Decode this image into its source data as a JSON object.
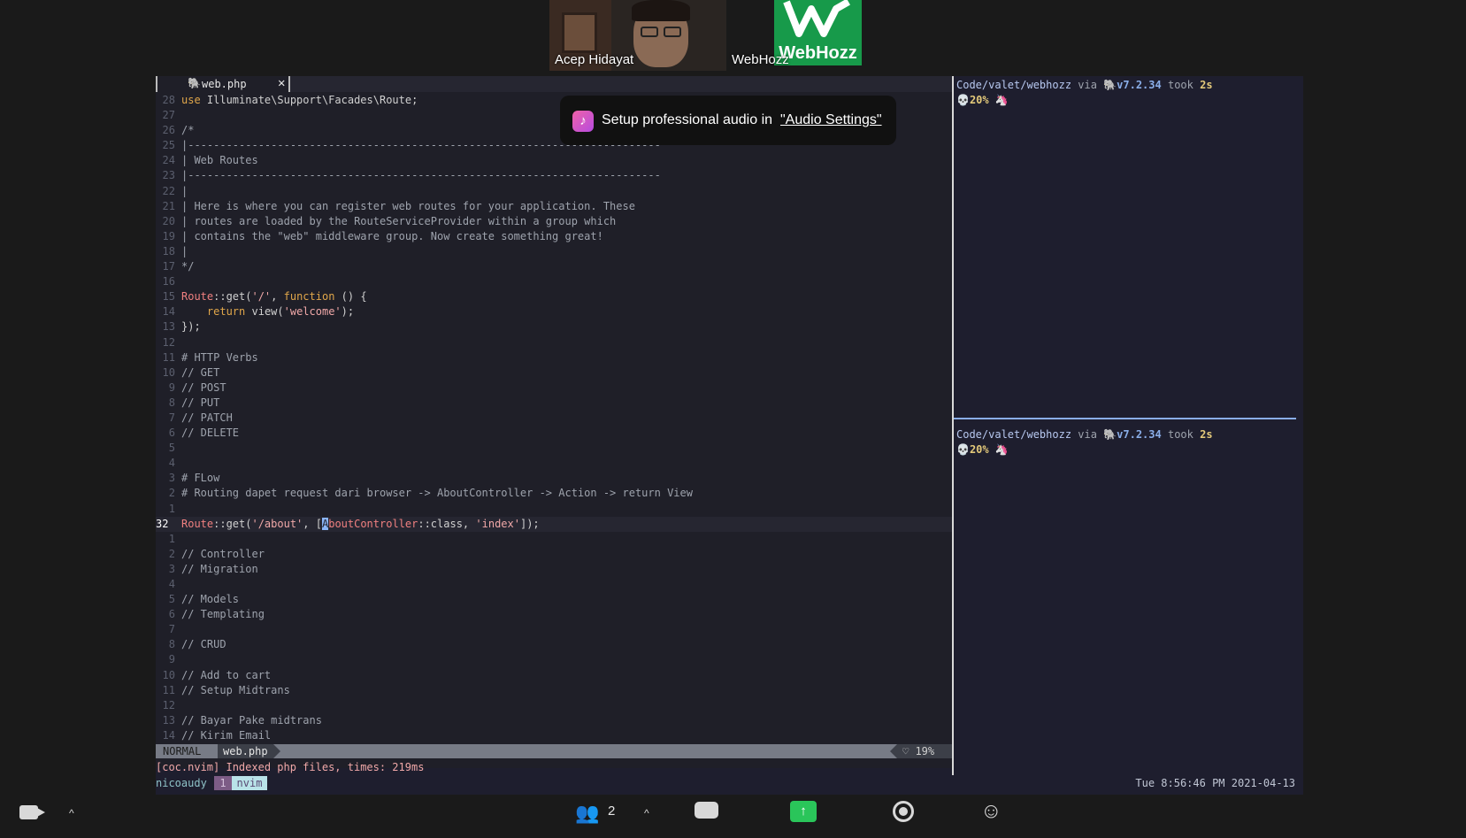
{
  "meeting": {
    "participants": [
      {
        "name": "Acep Hidayat"
      },
      {
        "name": "WebHozz"
      }
    ],
    "webhozz_logo_text": "WebHozz"
  },
  "toast": {
    "text": "Setup professional audio in",
    "link": "\"Audio Settings\""
  },
  "editor": {
    "tab_label": "web.php",
    "tab_close": "✕",
    "lines": [
      {
        "n": "28",
        "parts": [
          [
            "kw",
            "use"
          ],
          [
            "fn",
            " Illuminate\\Support\\Facades\\Route;"
          ]
        ]
      },
      {
        "n": "27",
        "parts": []
      },
      {
        "n": "26",
        "parts": [
          [
            "comment",
            "/*"
          ]
        ]
      },
      {
        "n": "25",
        "parts": [
          [
            "comment",
            "|--------------------------------------------------------------------------"
          ]
        ]
      },
      {
        "n": "24",
        "parts": [
          [
            "comment",
            "| Web Routes"
          ]
        ]
      },
      {
        "n": "23",
        "parts": [
          [
            "comment",
            "|--------------------------------------------------------------------------"
          ]
        ]
      },
      {
        "n": "22",
        "parts": [
          [
            "comment",
            "|"
          ]
        ]
      },
      {
        "n": "21",
        "parts": [
          [
            "comment",
            "| Here is where you can register web routes for your application. These"
          ]
        ]
      },
      {
        "n": "20",
        "parts": [
          [
            "comment",
            "| routes are loaded by the RouteServiceProvider within a group which"
          ]
        ]
      },
      {
        "n": "19",
        "parts": [
          [
            "comment",
            "| contains the \"web\" middleware group. Now create something great!"
          ]
        ]
      },
      {
        "n": "18",
        "parts": [
          [
            "comment",
            "|"
          ]
        ]
      },
      {
        "n": "17",
        "parts": [
          [
            "comment",
            "*/"
          ]
        ]
      },
      {
        "n": "16",
        "parts": []
      },
      {
        "n": "15",
        "parts": [
          [
            "cls",
            "Route"
          ],
          [
            "fn",
            "::get("
          ],
          [
            "str",
            "'/'"
          ],
          [
            "fn",
            ", "
          ],
          [
            "kw",
            "function"
          ],
          [
            "fn",
            " () {"
          ]
        ]
      },
      {
        "n": "14",
        "parts": [
          [
            "fn",
            "    "
          ],
          [
            "kw",
            "return"
          ],
          [
            "fn",
            " view("
          ],
          [
            "str",
            "'welcome'"
          ],
          [
            "fn",
            ");"
          ]
        ]
      },
      {
        "n": "13",
        "parts": [
          [
            "fn",
            "});"
          ]
        ]
      },
      {
        "n": "12",
        "parts": []
      },
      {
        "n": "11",
        "parts": [
          [
            "comment",
            "# HTTP Verbs"
          ]
        ]
      },
      {
        "n": "10",
        "parts": [
          [
            "comment",
            "// GET"
          ]
        ]
      },
      {
        "n": "9",
        "parts": [
          [
            "comment",
            "// POST"
          ]
        ]
      },
      {
        "n": "8",
        "parts": [
          [
            "comment",
            "// PUT"
          ]
        ]
      },
      {
        "n": "7",
        "parts": [
          [
            "comment",
            "// PATCH"
          ]
        ]
      },
      {
        "n": "6",
        "parts": [
          [
            "comment",
            "// DELETE"
          ]
        ]
      },
      {
        "n": "5",
        "parts": []
      },
      {
        "n": "4",
        "parts": []
      },
      {
        "n": "3",
        "parts": [
          [
            "comment",
            "# FLow"
          ]
        ]
      },
      {
        "n": "2",
        "parts": [
          [
            "comment",
            "# Routing dapet request dari browser -> AboutController -> Action -> return View"
          ]
        ]
      },
      {
        "n": "1",
        "parts": []
      },
      {
        "n": "32",
        "current": true,
        "parts": [
          [
            "cls",
            "Route"
          ],
          [
            "fn",
            "::get("
          ],
          [
            "str",
            "'/about'"
          ],
          [
            "fn",
            ", ["
          ],
          [
            "cursor",
            "A"
          ],
          [
            "cls",
            "b"
          ],
          [
            "cls",
            "outController"
          ],
          [
            "fn",
            "::class, "
          ],
          [
            "str",
            "'index'"
          ],
          [
            "fn",
            "]);"
          ]
        ]
      },
      {
        "n": "1",
        "parts": []
      },
      {
        "n": "2",
        "parts": [
          [
            "comment",
            "// Controller"
          ]
        ]
      },
      {
        "n": "3",
        "parts": [
          [
            "comment",
            "// Migration"
          ]
        ]
      },
      {
        "n": "4",
        "parts": []
      },
      {
        "n": "5",
        "parts": [
          [
            "comment",
            "// Models"
          ]
        ]
      },
      {
        "n": "6",
        "parts": [
          [
            "comment",
            "// Templating"
          ]
        ]
      },
      {
        "n": "7",
        "parts": []
      },
      {
        "n": "8",
        "parts": [
          [
            "comment",
            "// CRUD"
          ]
        ]
      },
      {
        "n": "9",
        "parts": []
      },
      {
        "n": "10",
        "parts": [
          [
            "comment",
            "// Add to cart"
          ]
        ]
      },
      {
        "n": "11",
        "parts": [
          [
            "comment",
            "// Setup Midtrans"
          ]
        ]
      },
      {
        "n": "12",
        "parts": []
      },
      {
        "n": "13",
        "parts": [
          [
            "comment",
            "// Bayar Pake midtrans"
          ]
        ]
      },
      {
        "n": "14",
        "parts": [
          [
            "comment",
            "// Kirim Email"
          ]
        ]
      }
    ],
    "status": {
      "mode": "NORMAL",
      "file": "web.php",
      "right": "♡ 19%"
    },
    "cmdline": "[coc.nvim] Indexed php files, times: 219ms"
  },
  "shell": {
    "path": "Code/valet/webhozz",
    "via": "via",
    "php_icon": "🐘",
    "version": "v7.2.34",
    "took": "took",
    "duration": "2s",
    "skull": "💀",
    "battery": "20%",
    "unicorn": "🦄"
  },
  "tmux": {
    "session": "nicoaudy",
    "window_index": "1",
    "window_name": "nvim",
    "clock": "Tue 8:56:46 PM 2021-04-13"
  },
  "toolbar": {
    "participants_count": "2"
  },
  "colors": {
    "share_green": "#2ac55a",
    "webhozz_green": "#179a4a"
  }
}
